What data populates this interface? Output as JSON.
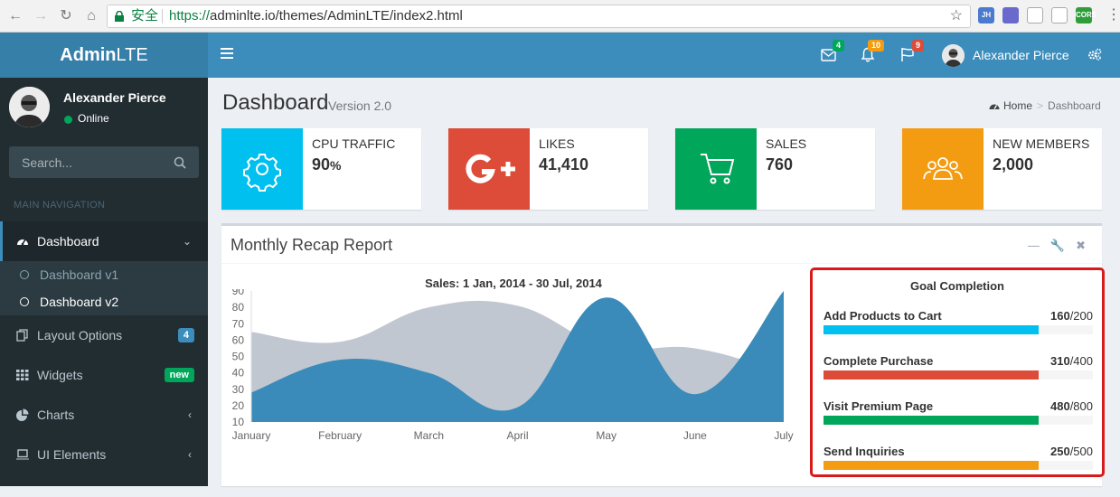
{
  "browser": {
    "secure_label": "安全",
    "url_scheme": "https://",
    "url_rest": "adminlte.io/themes/AdminLTE/index2.html",
    "extensions": [
      {
        "name": "jh-extension-icon",
        "label": "JH",
        "color": "#4a7bd0"
      },
      {
        "name": "extension-icon-2",
        "label": "",
        "color": "#6a6acd"
      },
      {
        "name": "react-devtools-icon",
        "label": "",
        "color": "#ffffff"
      },
      {
        "name": "qr-code-icon",
        "label": "",
        "color": "#ffffff"
      },
      {
        "name": "cors-extension-icon",
        "label": "CORS",
        "color": "#2e9e3a"
      }
    ]
  },
  "header": {
    "logo_bold": "Admin",
    "logo_rest": "LTE",
    "messages_badge": "4",
    "notifications_badge": "10",
    "tasks_badge": "9",
    "user_name": "Alexander Pierce",
    "badge_colors": {
      "messages": "#00a65a",
      "notifications": "#f39c12",
      "tasks": "#dd4b39"
    }
  },
  "sidebar": {
    "user_name": "Alexander Pierce",
    "status": "Online",
    "search_placeholder": "Search...",
    "nav_header": "MAIN NAVIGATION",
    "dashboard_label": "Dashboard",
    "sub_items": [
      {
        "label": "Dashboard v1"
      },
      {
        "label": "Dashboard v2"
      }
    ],
    "items": [
      {
        "label": "Layout Options",
        "badge": "4",
        "badge_color": "#3c8dbc"
      },
      {
        "label": "Widgets",
        "badge": "new",
        "badge_color": "#00a65a"
      },
      {
        "label": "Charts"
      },
      {
        "label": "UI Elements"
      }
    ]
  },
  "content": {
    "title": "Dashboard",
    "subtitle": "Version 2.0",
    "breadcrumb": {
      "home": "Home",
      "current": "Dashboard"
    },
    "info_boxes": [
      {
        "label": "CPU TRAFFIC",
        "value": "90",
        "unit": "%",
        "color": "#00c0ef",
        "icon": "gear-icon"
      },
      {
        "label": "LIKES",
        "value": "41,410",
        "color": "#dd4b39",
        "icon": "google-plus-icon"
      },
      {
        "label": "SALES",
        "value": "760",
        "color": "#00a65a",
        "icon": "shopping-cart-icon"
      },
      {
        "label": "NEW MEMBERS",
        "value": "2,000",
        "color": "#f39c12",
        "icon": "users-icon"
      }
    ],
    "report": {
      "title": "Monthly Recap Report",
      "goal": {
        "title": "Goal Completion",
        "items": [
          {
            "label": "Add Products to Cart",
            "value": "160",
            "total": "/200",
            "fraction": 0.8,
            "color": "#00c0ef"
          },
          {
            "label": "Complete Purchase",
            "value": "310",
            "total": "/400",
            "fraction": 0.8,
            "color": "#dd4b39"
          },
          {
            "label": "Visit Premium Page",
            "value": "480",
            "total": "/800",
            "fraction": 0.8,
            "color": "#00a65a"
          },
          {
            "label": "Send Inquiries",
            "value": "250",
            "total": "/500",
            "fraction": 0.8,
            "color": "#f39c12"
          }
        ]
      }
    }
  },
  "chart_data": {
    "type": "area",
    "title": "Sales: 1 Jan, 2014 - 30 Jul, 2014",
    "categories": [
      "January",
      "February",
      "March",
      "April",
      "May",
      "June",
      "July"
    ],
    "series": [
      {
        "values": [
          65,
          59,
          80,
          81,
          56,
          55,
          40
        ],
        "color": "#c1c7d1"
      },
      {
        "values": [
          28,
          48,
          40,
          19,
          86,
          27,
          90
        ],
        "color": "#3b8bba"
      }
    ],
    "yticks": [
      10,
      20,
      30,
      40,
      50,
      60,
      70,
      80,
      90
    ],
    "ylim": [
      10,
      90
    ],
    "grid": false
  }
}
